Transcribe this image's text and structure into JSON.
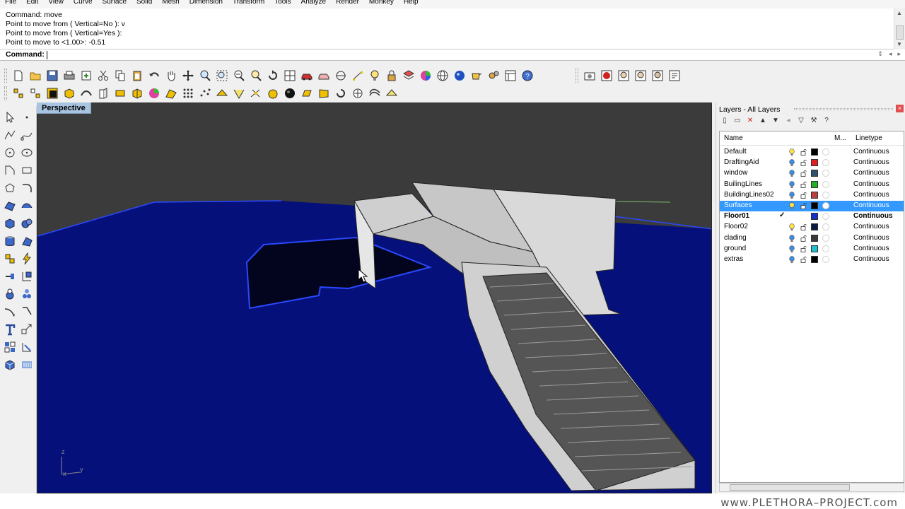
{
  "menu": [
    "File",
    "Edit",
    "View",
    "Curve",
    "Surface",
    "Solid",
    "Mesh",
    "Dimension",
    "Transform",
    "Tools",
    "Analyze",
    "Render",
    "Monkey",
    "Help"
  ],
  "command_history": [
    "Command: move",
    "Point to move from ( Vertical=No ): v",
    "Point to move from ( Vertical=Yes ):",
    "Point to move to <1.00>: -0.51"
  ],
  "command_prompt": "Command:",
  "viewport": {
    "name": "Perspective",
    "axis_x": "x",
    "axis_y": "y",
    "axis_z": "z"
  },
  "layers_panel": {
    "title": "Layers - All Layers",
    "columns": {
      "name": "Name",
      "material": "M...",
      "linetype": "Linetype"
    },
    "rows": [
      {
        "name": "Default",
        "color": "#000000",
        "bulb": "on-yellow",
        "linetype": "Continuous",
        "current": false,
        "selected": false
      },
      {
        "name": "DraftingAid",
        "color": "#e02020",
        "bulb": "on-blue",
        "linetype": "Continuous",
        "current": false,
        "selected": false
      },
      {
        "name": "window",
        "color": "#2f4f6f",
        "bulb": "on-blue",
        "linetype": "Continuous",
        "current": false,
        "selected": false
      },
      {
        "name": "BuilingLines",
        "color": "#20b020",
        "bulb": "on-blue",
        "linetype": "Continuous",
        "current": false,
        "selected": false
      },
      {
        "name": "BuildingLines02",
        "color": "#b84040",
        "bulb": "on-blue",
        "linetype": "Continuous",
        "current": false,
        "selected": false
      },
      {
        "name": "Surfaces",
        "color": "#000000",
        "bulb": "on-yellow",
        "linetype": "Continuous",
        "current": false,
        "selected": true
      },
      {
        "name": "Floor01",
        "color": "#1030d0",
        "bulb": "none",
        "linetype": "Continuous",
        "current": true,
        "selected": false
      },
      {
        "name": "Floor02",
        "color": "#0a1a40",
        "bulb": "on-yellow",
        "linetype": "Continuous",
        "current": false,
        "selected": false
      },
      {
        "name": "clading",
        "color": "#3a3a3a",
        "bulb": "on-blue",
        "linetype": "Continuous",
        "current": false,
        "selected": false
      },
      {
        "name": "ground",
        "color": "#20c0d0",
        "bulb": "on-blue",
        "linetype": "Continuous",
        "current": false,
        "selected": false
      },
      {
        "name": "extras",
        "color": "#000000",
        "bulb": "on-blue",
        "linetype": "Continuous",
        "current": false,
        "selected": false
      }
    ],
    "current_mark": "✓"
  },
  "watermark": "www.PLETHORA–PROJECT.com",
  "colors": {
    "viewport_bg": "#3b3b3b",
    "ground_plane": "#05107a",
    "selection": "#3399ff",
    "viewport_tab": "#a8c4e0"
  }
}
